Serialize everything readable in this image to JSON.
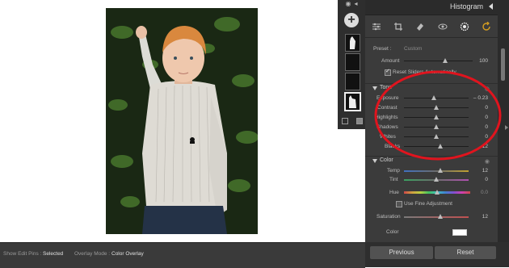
{
  "canvas": {
    "pin_icon": "pin-icon"
  },
  "mask_panel": {
    "top_icons": [
      "eye-icon",
      "chevron-icon"
    ],
    "add_label": "+",
    "thumbnails": 4
  },
  "panel": {
    "title": "Histogram",
    "tools": [
      "sliders-icon",
      "crop-icon",
      "eraser-icon",
      "redeye-icon",
      "mask-icon",
      "refresh-icon"
    ],
    "preset": {
      "label": "Preset :",
      "value": "Custom"
    },
    "amount": {
      "label": "Amount",
      "value": "100",
      "level": 0.6
    },
    "reset_sliders": {
      "label": "Reset Sliders Automatically",
      "checked": true
    },
    "tone": {
      "name": "Tone",
      "sliders": [
        {
          "label": "Exposure",
          "value": "– 0.23",
          "level": 0.46
        },
        {
          "label": "Contrast",
          "value": "0",
          "level": 0.5
        },
        {
          "label": "Highlights",
          "value": "0",
          "level": 0.5
        },
        {
          "label": "Shadows",
          "value": "0",
          "level": 0.5
        },
        {
          "label": "Whites",
          "value": "0",
          "level": 0.5
        },
        {
          "label": "Blacks",
          "value": "12",
          "level": 0.56
        }
      ]
    },
    "color": {
      "name": "Color",
      "temp": {
        "label": "Temp",
        "value": "12",
        "level": 0.56
      },
      "tint": {
        "label": "Tint",
        "value": "0",
        "level": 0.5
      },
      "hue": {
        "label": "Hue",
        "value": "0.0",
        "level": 0.5
      },
      "fine": {
        "label": "Use Fine Adjustment",
        "checked": false
      },
      "saturation": {
        "label": "Saturation",
        "value": "12",
        "level": 0.56
      },
      "color_label": "Color"
    }
  },
  "bottom": {
    "show_pins_label": "Show Edit Pins :",
    "show_pins_value": "Selected",
    "overlay_label": "Overlay Mode :",
    "overlay_value": "Color Overlay",
    "previous": "Previous",
    "reset": "Reset"
  },
  "colors": {
    "accent_red": "#e0141e",
    "panel_bg": "#3b3b3b"
  }
}
